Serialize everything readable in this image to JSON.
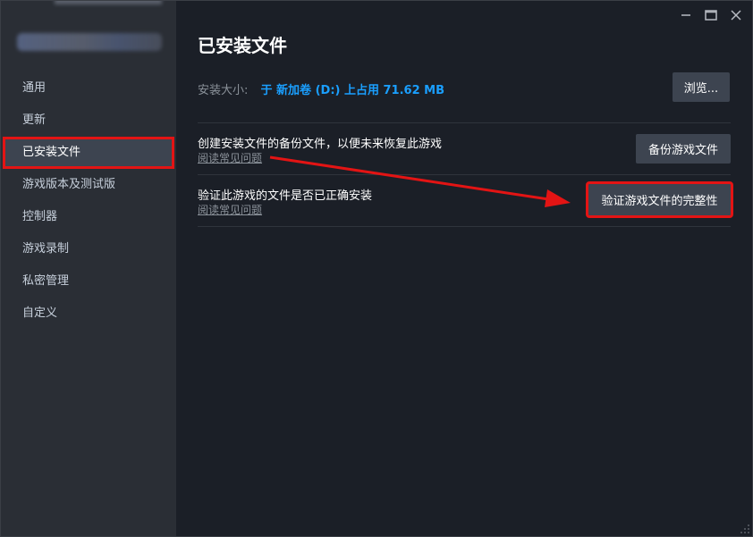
{
  "window": {
    "controls": {
      "minimize_glyph": "—",
      "maximize_glyph": "☐",
      "close_glyph": "✕"
    }
  },
  "sidebar": {
    "items": [
      {
        "label": "通用",
        "active": false
      },
      {
        "label": "更新",
        "active": false
      },
      {
        "label": "已安装文件",
        "active": true
      },
      {
        "label": "游戏版本及测试版",
        "active": false
      },
      {
        "label": "控制器",
        "active": false
      },
      {
        "label": "游戏录制",
        "active": false
      },
      {
        "label": "私密管理",
        "active": false
      },
      {
        "label": "自定义",
        "active": false
      }
    ]
  },
  "main": {
    "title": "已安装文件",
    "install_size": {
      "label": "安装大小:",
      "value": "于 新加卷 (D:) 上占用 71.62 MB"
    },
    "browse_button": "浏览...",
    "backup": {
      "title": "创建安装文件的备份文件，以便未来恢复此游戏",
      "faq": "阅读常见问题",
      "button": "备份游戏文件"
    },
    "verify": {
      "title": "验证此游戏的文件是否已正确安装",
      "faq": "阅读常见问题",
      "button": "验证游戏文件的完整性"
    }
  },
  "colors": {
    "accent_blue": "#1a9fff",
    "highlight_red": "#e31414",
    "sidebar_bg": "#2a2e35",
    "main_bg": "#1b1f27",
    "button_bg": "#3d4450"
  }
}
